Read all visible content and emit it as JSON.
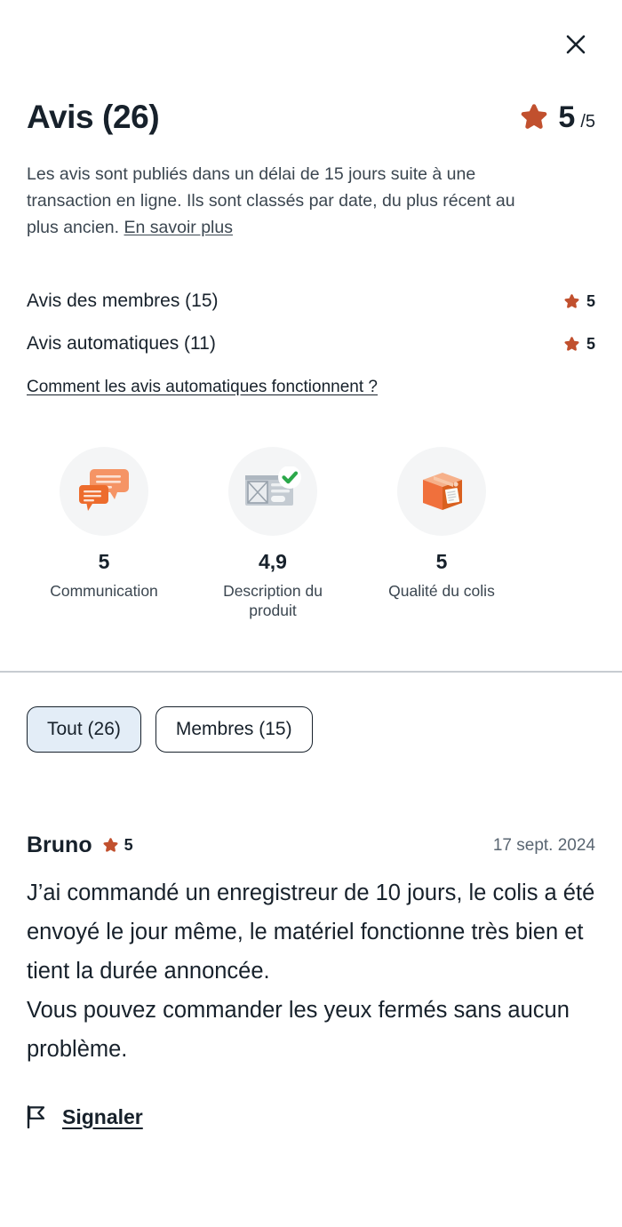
{
  "modal": {
    "close_icon": "close-icon"
  },
  "header": {
    "title": "Avis (26)",
    "rating_value": "5",
    "rating_out_of": "/5",
    "star_icon": "star-icon"
  },
  "disclaimer": {
    "text": "Les avis sont publiés dans un délai de 15 jours suite à une transaction en ligne. Ils sont classés par date, du plus récent au plus ancien. ",
    "link_label": "En savoir plus"
  },
  "breakdown": {
    "rows": [
      {
        "label": "Avis des membres (15)",
        "score": "5"
      },
      {
        "label": "Avis automatiques (11)",
        "score": "5"
      }
    ],
    "how_link": "Comment les avis automatiques fonctionnent ?"
  },
  "criteria": [
    {
      "icon": "speech-bubbles-icon",
      "score": "5",
      "label": "Communication"
    },
    {
      "icon": "product-listing-check-icon",
      "score": "4,9",
      "label": "Description du produit"
    },
    {
      "icon": "parcel-box-icon",
      "score": "5",
      "label": "Qualité du colis"
    }
  ],
  "filters": [
    {
      "label": "Tout (26)",
      "selected": true
    },
    {
      "label": "Membres (15)",
      "selected": false
    }
  ],
  "review": {
    "author": "Bruno",
    "rating": "5",
    "date": "17 sept. 2024",
    "paragraphs": [
      "J’ai commandé un enregistreur de 10 jours, le colis a été envoyé le jour même, le matériel fonctionne très bien et tient la durée annoncée.",
      "Vous pouvez commander les yeux fermés sans aucun problème."
    ],
    "report_label": "Signaler",
    "report_icon": "flag-icon"
  },
  "colors": {
    "star": "#C1502E",
    "text": "#17212B",
    "muted": "#3B4650",
    "chip_selected_bg": "#E3EDF7",
    "divider": "#C7CCD1",
    "icon_circle_bg": "#F4F5F6",
    "check_green": "#2BA84A",
    "box_orange": "#F0703C"
  }
}
